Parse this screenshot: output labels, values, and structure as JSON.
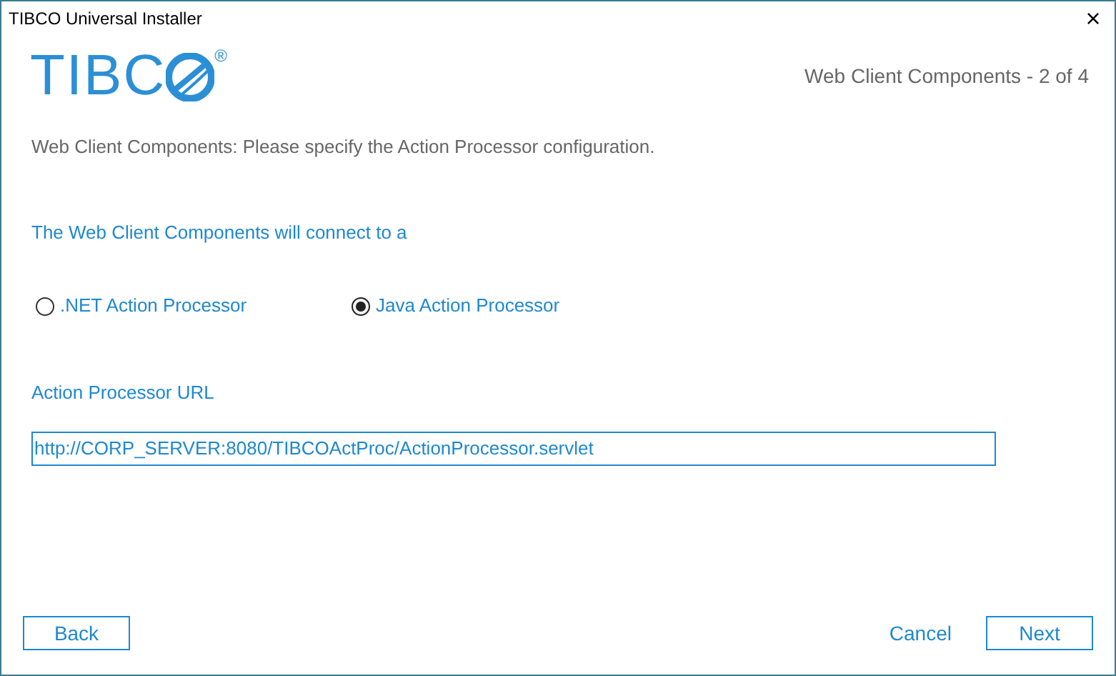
{
  "window": {
    "title": "TIBCO Universal Installer",
    "close": "×"
  },
  "logo": {
    "text": "TIBC",
    "mark": "®"
  },
  "step": "Web Client Components - 2 of 4",
  "instructions": "Web Client Components: Please specify the Action Processor configuration.",
  "connect_label": "The Web Client Components will connect to a",
  "processors": [
    {
      "label": ".NET Action Processor",
      "selected": false
    },
    {
      "label": "Java Action Processor",
      "selected": true
    }
  ],
  "url_field": {
    "label": "Action Processor URL",
    "value": "http://CORP_SERVER:8080/TIBCOActProc/ActionProcessor.servlet"
  },
  "buttons": [
    {
      "label": "Back",
      "kind": "outlined"
    },
    {
      "label": "Cancel",
      "kind": "link"
    },
    {
      "label": "Next",
      "kind": "outlined"
    }
  ]
}
